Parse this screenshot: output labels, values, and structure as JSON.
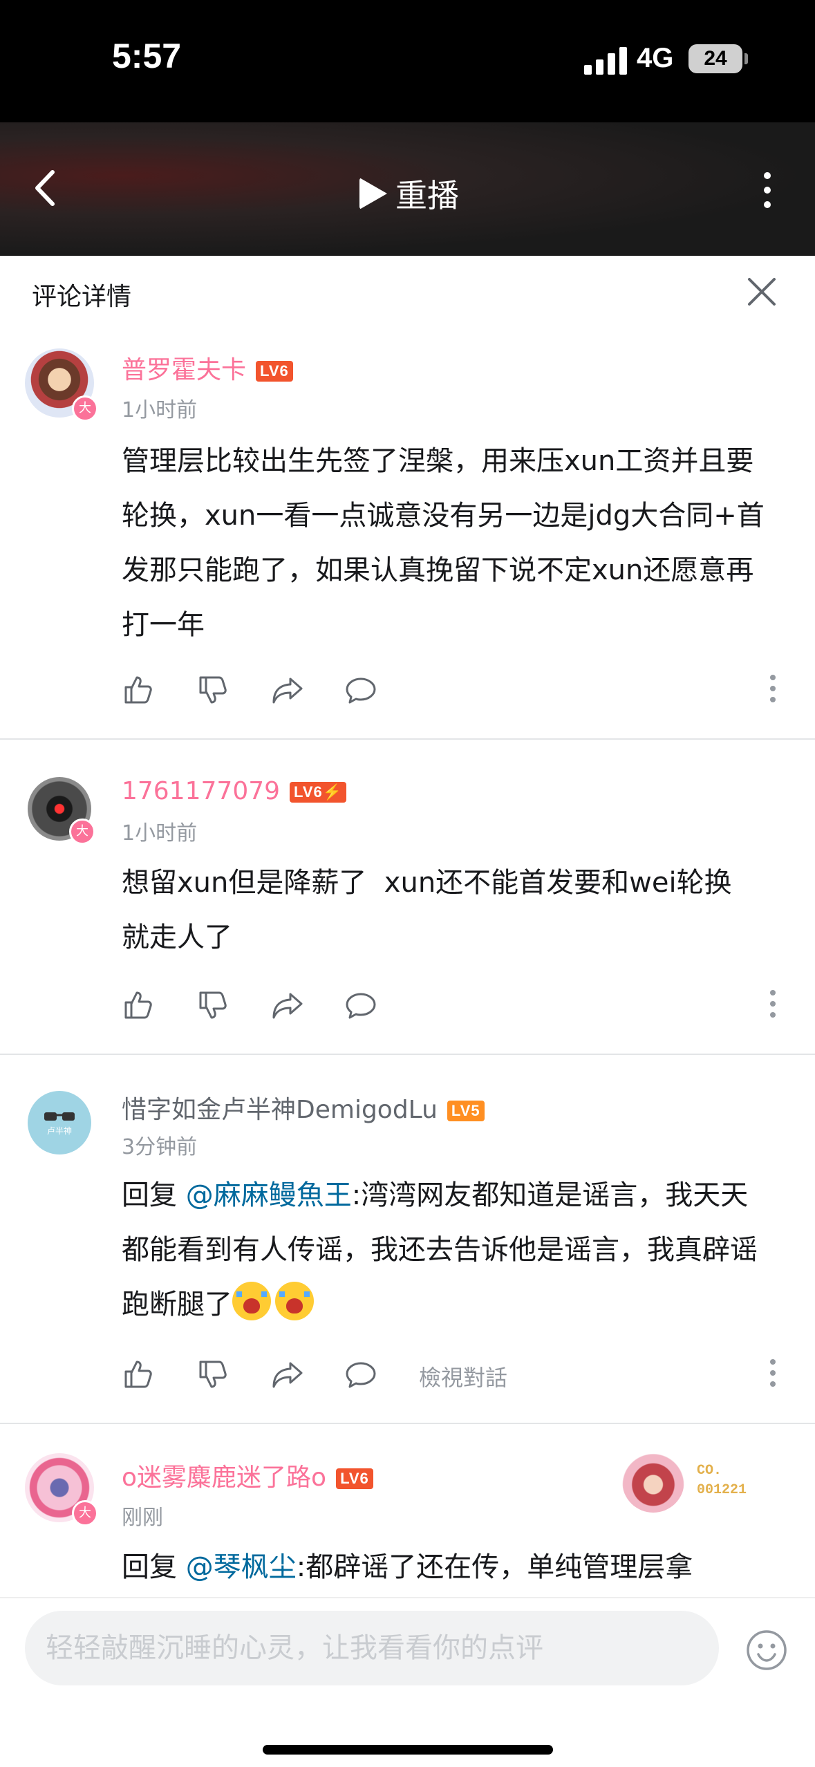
{
  "status": {
    "time": "5:57",
    "network": "4G",
    "battery": "24"
  },
  "header": {
    "replay_label": "重播"
  },
  "panel": {
    "title": "评论详情"
  },
  "comments": [
    {
      "username": "普罗霍夫卡",
      "level": "LV6",
      "time": "1小时前",
      "text": "管理层比较出生先签了涅槃，用来压xun工资并且要轮换，xun一看一点诚意没有另一边是jdg大合同+首发那只能跑了，如果认真挽留下说不定xun还愿意再打一年",
      "badge": "大"
    },
    {
      "username": "1761177079",
      "level": "LV6⚡",
      "time": "1小时前",
      "text": "想留xun但是降薪了  xun还不能首发要和wei轮换  就走人了",
      "badge": "大"
    },
    {
      "username": "惜字如金卢半神DemigodLu",
      "level": "LV5",
      "time": "3分钟前",
      "reply_prefix": "回复 ",
      "reply_to": "@麻麻鳗魚王",
      "text": ":湾湾网友都知道是谣言，我天天都能看到有人传谣，我还去告诉他是谣言，我真辟谣跑断腿了",
      "emojis": [
        "crying-emoji",
        "crying-emoji"
      ],
      "view_conversation": "檢視對話",
      "avatar_text": "卢半神"
    },
    {
      "username": "o迷雾麋鹿迷了路o",
      "level": "LV6",
      "time": "刚刚",
      "reply_prefix": "回复 ",
      "reply_to": "@琴枫尘",
      "text": ":都辟谣了还在传，单纯管理层拿",
      "badge": "大",
      "decoration_label": "CO.",
      "decoration_number": "001221"
    }
  ],
  "input": {
    "placeholder": "轻轻敲醒沉睡的心灵，让我看看你的点评"
  },
  "colors": {
    "accent_pink": "#fb7299",
    "link_blue": "#00699d",
    "level_red": "#f2542d",
    "level_orange": "#ff8f22"
  }
}
